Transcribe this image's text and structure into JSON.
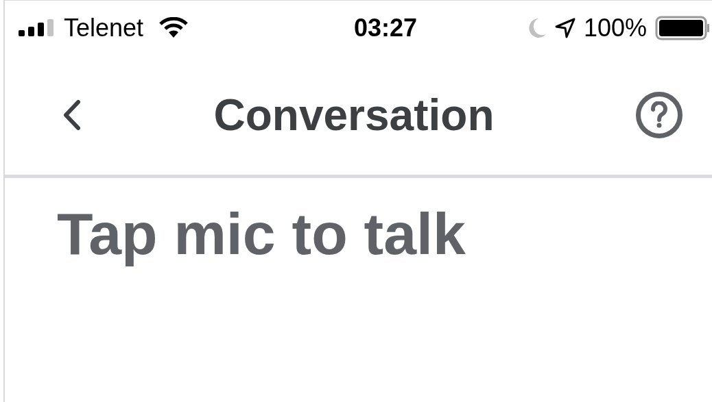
{
  "status_bar": {
    "carrier": "Telenet",
    "time": "03:27",
    "battery": "100%"
  },
  "header": {
    "title": "Conversation"
  },
  "prompt": "Tap mic to talk"
}
